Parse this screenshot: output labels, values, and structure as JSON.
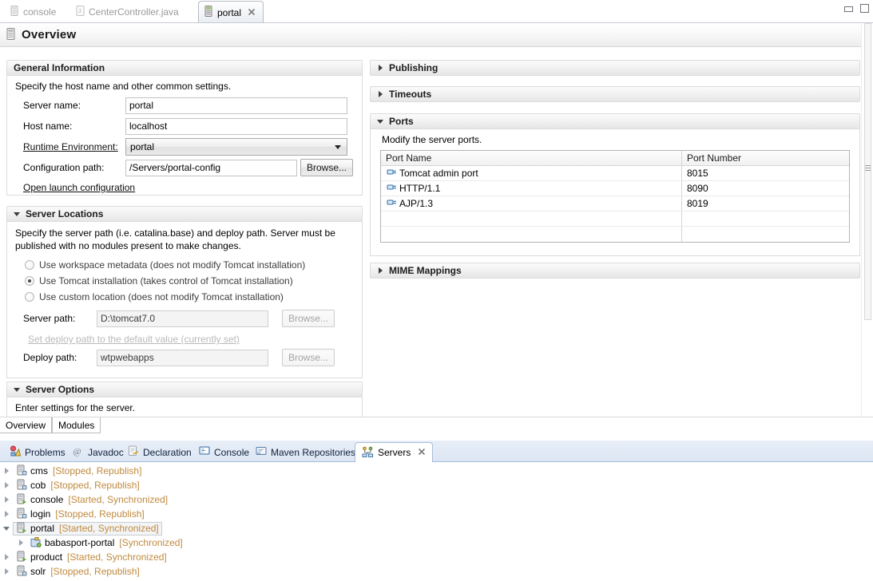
{
  "window": {
    "minimize_label": "Minimize",
    "maximize_label": "Maximize"
  },
  "editor_tabs": [
    {
      "label": "console",
      "icon": "server-icon",
      "active": false
    },
    {
      "label": "CenterController.java",
      "icon": "java-file-icon",
      "active": false
    },
    {
      "label": "portal",
      "icon": "server-icon",
      "active": true,
      "close_label": "✖"
    }
  ],
  "form": {
    "title": "Overview",
    "icon": "server-icon"
  },
  "general_information": {
    "title": "General Information",
    "description": "Specify the host name and other common settings.",
    "fields": {
      "server_name_label": "Server name:",
      "server_name_value": "portal",
      "host_name_label": "Host name:",
      "host_name_value": "localhost",
      "runtime_environment_label": "Runtime Environment:",
      "runtime_environment_value": "portal",
      "configuration_path_label": "Configuration path:",
      "configuration_path_value": "/Servers/portal-config",
      "browse_label": "Browse...",
      "open_launch_configuration_label": "Open launch configuration"
    }
  },
  "server_locations": {
    "title": "Server Locations",
    "description": "Specify the server path (i.e. catalina.base) and deploy path. Server must be published with no modules present to make changes.",
    "options": [
      {
        "label": "Use workspace metadata (does not modify Tomcat installation)",
        "selected": false
      },
      {
        "label": "Use Tomcat installation (takes control of Tomcat installation)",
        "selected": true
      },
      {
        "label": "Use custom location (does not modify Tomcat installation)",
        "selected": false
      }
    ],
    "server_path_label": "Server path:",
    "server_path_value": "D:\\tomcat7.0",
    "server_path_browse_label": "Browse...",
    "set_deploy_path_link": "Set deploy path to the default value (currently set)",
    "deploy_path_label": "Deploy path:",
    "deploy_path_value": "wtpwebapps",
    "deploy_path_browse_label": "Browse..."
  },
  "server_options": {
    "title": "Server Options",
    "description": "Enter settings for the server."
  },
  "publishing": {
    "title": "Publishing",
    "expanded": false
  },
  "timeouts": {
    "title": "Timeouts",
    "expanded": false
  },
  "ports": {
    "title": "Ports",
    "expanded": true,
    "description": "Modify the server ports.",
    "columns": [
      "Port Name",
      "Port Number"
    ],
    "rows": [
      {
        "name": "Tomcat admin port",
        "number": "8015",
        "icon": "port-icon"
      },
      {
        "name": "HTTP/1.1",
        "number": "8090",
        "icon": "port-icon"
      },
      {
        "name": "AJP/1.3",
        "number": "8019",
        "icon": "port-icon"
      }
    ]
  },
  "mime_mappings": {
    "title": "MIME Mappings",
    "expanded": false
  },
  "page_tabs": [
    {
      "label": "Overview",
      "active": true
    },
    {
      "label": "Modules",
      "active": false
    }
  ],
  "view_tabs": [
    {
      "label": "Problems",
      "icon": "problems-icon",
      "active": false
    },
    {
      "label": "Javadoc",
      "icon": "javadoc-icon",
      "active": false
    },
    {
      "label": "Declaration",
      "icon": "declaration-icon",
      "active": false
    },
    {
      "label": "Console",
      "icon": "console-icon",
      "active": false
    },
    {
      "label": "Maven Repositories",
      "icon": "maven-icon",
      "active": false
    },
    {
      "label": "Servers",
      "icon": "servers-icon",
      "active": true,
      "close_label": "✖"
    }
  ],
  "servers_tree": [
    {
      "name": "cms",
      "status": "[Stopped, Republish]",
      "expanded": false,
      "indent": 0,
      "running": false,
      "selected": false,
      "icon": "server-icon"
    },
    {
      "name": "cob",
      "status": "[Stopped, Republish]",
      "expanded": false,
      "indent": 0,
      "running": false,
      "selected": false,
      "icon": "server-icon"
    },
    {
      "name": "console",
      "status": "[Started, Synchronized]",
      "expanded": false,
      "indent": 0,
      "running": true,
      "selected": false,
      "icon": "server-icon"
    },
    {
      "name": "login",
      "status": "[Stopped, Republish]",
      "expanded": false,
      "indent": 0,
      "running": false,
      "selected": false,
      "icon": "server-icon"
    },
    {
      "name": "portal",
      "status": "[Started, Synchronized]",
      "expanded": true,
      "indent": 0,
      "running": true,
      "selected": true,
      "icon": "server-icon"
    },
    {
      "name": "babasport-portal",
      "status": "[Synchronized]",
      "expanded": false,
      "indent": 1,
      "running": true,
      "selected": false,
      "icon": "module-icon"
    },
    {
      "name": "product",
      "status": "[Started, Synchronized]",
      "expanded": false,
      "indent": 0,
      "running": true,
      "selected": false,
      "icon": "server-icon"
    },
    {
      "name": "solr",
      "status": "[Stopped, Republish]",
      "expanded": false,
      "indent": 0,
      "running": false,
      "selected": false,
      "icon": "server-icon"
    }
  ],
  "colors": {
    "status_text": "#c08a3e",
    "tab_active_bg": "#ffffff",
    "view_tabbar_bg": "#dce6f4",
    "section_border": "#dcdcdc"
  }
}
